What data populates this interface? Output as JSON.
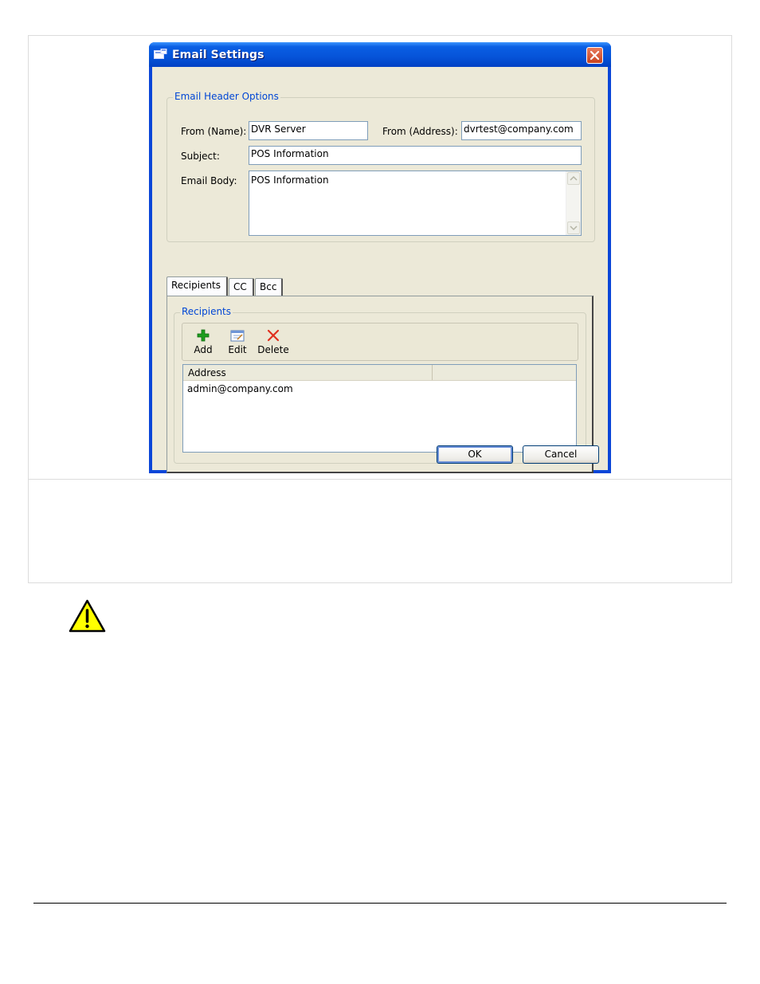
{
  "window": {
    "title": "Email Settings"
  },
  "header_options": {
    "legend": "Email Header Options",
    "from_name_label": "From (Name):",
    "from_name_value": "DVR Server",
    "from_address_label": "From (Address):",
    "from_address_value": "dvrtest@company.com",
    "subject_label": "Subject:",
    "subject_value": "POS Information",
    "body_label": "Email Body:",
    "body_value": "POS Information"
  },
  "tabs": [
    {
      "label": "Recipients",
      "active": true
    },
    {
      "label": "CC",
      "active": false
    },
    {
      "label": "Bcc",
      "active": false
    }
  ],
  "recipients": {
    "legend": "Recipients",
    "toolbar": {
      "add_label": "Add",
      "edit_label": "Edit",
      "delete_label": "Delete"
    },
    "columns": [
      "Address",
      ""
    ],
    "rows": [
      "admin@company.com"
    ]
  },
  "buttons": {
    "ok_label": "OK",
    "cancel_label": "Cancel"
  },
  "colors": {
    "titlebar": "#0653d8",
    "legend_text": "#0046d5",
    "dialog_background": "#ece9d8",
    "add_icon": "#1e9e1e",
    "delete_icon": "#e0301e",
    "warning_fill": "#ffff00"
  },
  "icons": {
    "title": "window-app-icon",
    "close": "close-icon",
    "add": "green-plus-icon",
    "edit": "edit-form-icon",
    "delete": "red-x-icon",
    "warning": "warning-triangle-icon"
  }
}
